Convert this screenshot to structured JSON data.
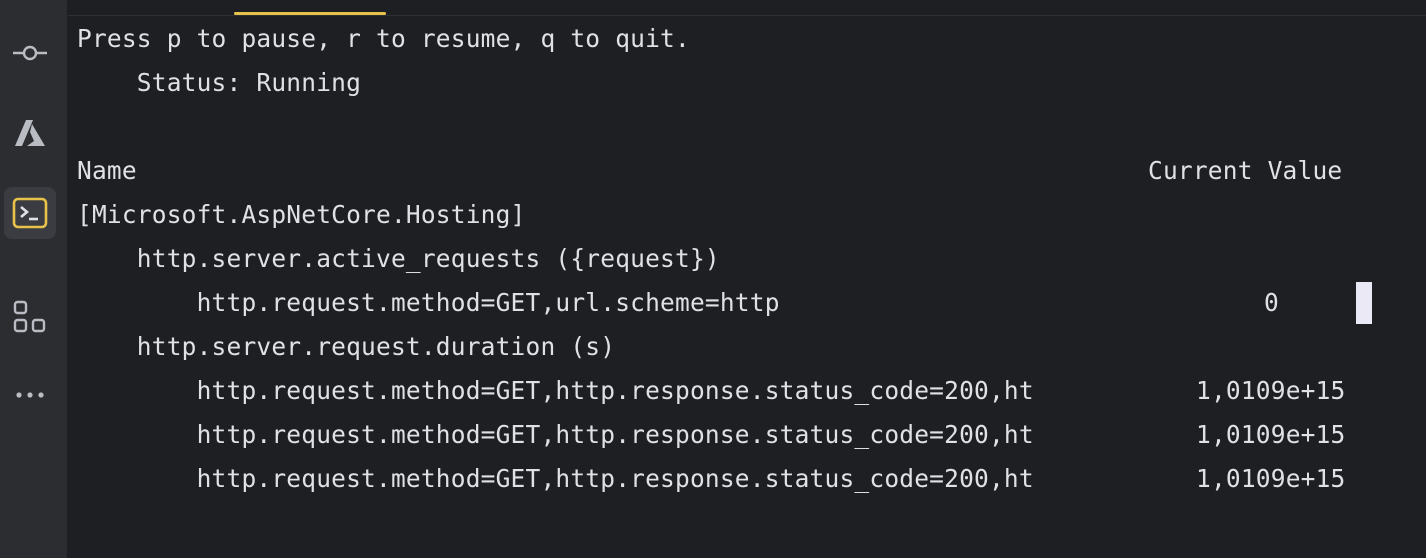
{
  "sidebar": {
    "items": [
      {
        "icon": "commit-icon"
      },
      {
        "icon": "azure-icon"
      },
      {
        "icon": "terminal-icon",
        "active": true
      },
      {
        "icon": "services-icon"
      },
      {
        "icon": "more-icon"
      }
    ]
  },
  "terminal": {
    "hint": "Press p to pause, r to resume, q to quit.",
    "status": "    Status: Running",
    "header_name": "Name",
    "header_value": "Current Value",
    "category": "[Microsoft.AspNetCore.Hosting]",
    "metric1_name": "    http.server.active_requests ({request})",
    "metric1_row1_label": "        http.request.method=GET,url.scheme=http",
    "metric1_row1_value": "0",
    "metric2_name": "    http.server.request.duration (s)",
    "rows": [
      {
        "label": "        http.request.method=GET,http.response.status_code=200,ht",
        "value": "1,0109e+15"
      },
      {
        "label": "        http.request.method=GET,http.response.status_code=200,ht",
        "value": "1,0109e+15"
      },
      {
        "label": "        http.request.method=GET,http.response.status_code=200,ht",
        "value": "1,0109e+15"
      }
    ]
  },
  "colors": {
    "background": "#1e1f22",
    "sidebar": "#2b2d30",
    "text": "#dfe1e5",
    "tab_accent": "#e8c24a",
    "terminal_icon_accent": "#e8c24a"
  }
}
